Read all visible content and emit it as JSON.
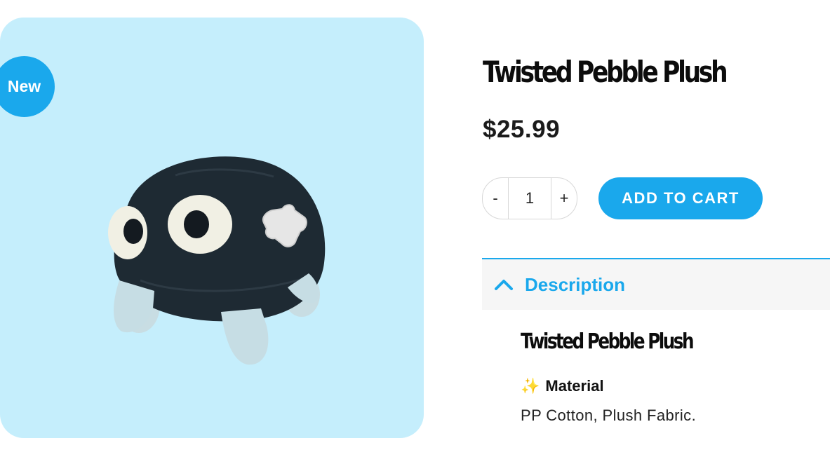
{
  "badge": {
    "label": "New"
  },
  "product": {
    "title": "Twisted Pebble Plush",
    "price": "$25.99",
    "image_alt": "black round plush toy with white eyes and a cross patch"
  },
  "quantity": {
    "decrement_label": "-",
    "value": "1",
    "increment_label": "+"
  },
  "cart": {
    "add_label": "ADD TO CART"
  },
  "accordion": {
    "label": "Description",
    "expanded": true,
    "icon": "chevron-up-icon"
  },
  "description": {
    "title": "Twisted Pebble Plush",
    "sparkle": "✨",
    "material_heading": "Material",
    "material_text": "PP Cotton, Plush Fabric."
  },
  "colors": {
    "accent": "#1aa8ec",
    "image_bg": "#c5eefc",
    "accordion_bg": "#f6f6f6"
  }
}
